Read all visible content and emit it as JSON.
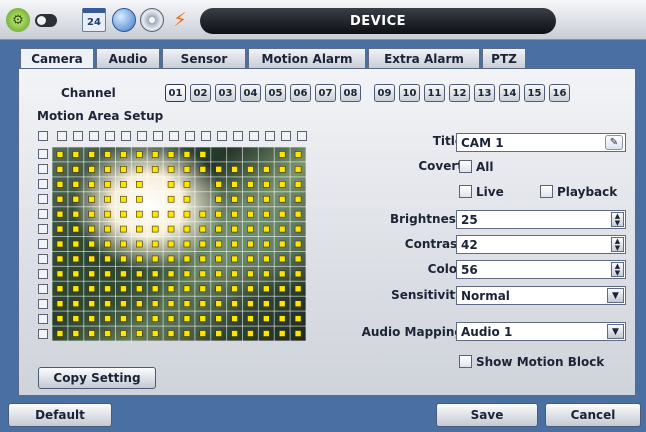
{
  "title": "DEVICE",
  "tabs": [
    "Camera",
    "Audio",
    "Sensor",
    "Motion Alarm",
    "Extra Alarm",
    "PTZ"
  ],
  "channel": {
    "label": "Channel",
    "buttons": [
      "01",
      "02",
      "03",
      "04",
      "05",
      "06",
      "07",
      "08",
      "09",
      "10",
      "11",
      "12",
      "13",
      "14",
      "15",
      "16"
    ],
    "selected": "01"
  },
  "motion_area_label": "Motion Area Setup",
  "form": {
    "title_label": "Title",
    "title_value": "CAM 1",
    "covert_label": "Covert",
    "all_label": "All",
    "live_label": "Live",
    "playback_label": "Playback",
    "brightness_label": "Brightness",
    "brightness_value": "25",
    "contrast_label": "Contrast",
    "contrast_value": "42",
    "color_label": "Color",
    "color_value": "56",
    "sensitivity_label": "Sensitivity",
    "sensitivity_value": "Normal",
    "audio_mapping_label": "Audio Mapping",
    "audio_mapping_value": "Audio 1",
    "show_motion_block_label": "Show Motion Block"
  },
  "buttons": {
    "copy_setting": "Copy Setting",
    "default": "Default",
    "save": "Save",
    "cancel": "Cancel"
  },
  "icons": [
    "gear-icon",
    "toggle-icon",
    "calendar-icon",
    "globe-icon",
    "disc-icon",
    "power-icon",
    "pencil-icon"
  ],
  "calendar_icon_text": "24",
  "colors": {
    "background": "#4a6fa3",
    "title_bar": "#0d0f13",
    "motion_cell": "#ffe600"
  }
}
